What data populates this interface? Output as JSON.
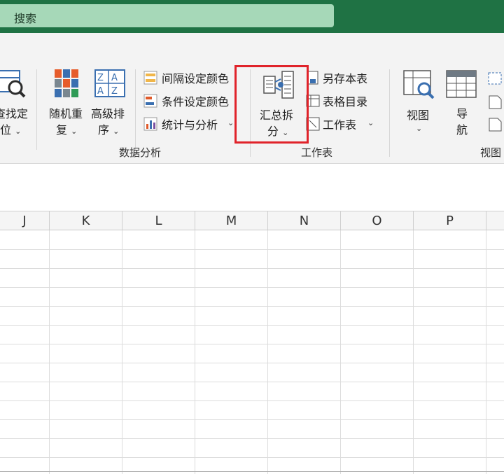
{
  "search": {
    "label": "搜索"
  },
  "ribbon": {
    "find_locate": {
      "line1": "查找定",
      "line2": "位"
    },
    "random_repeat": {
      "line1": "随机重",
      "line2": "复"
    },
    "advanced_sort": {
      "line1": "高级排",
      "line2": "序"
    },
    "interval_color": {
      "label": "间隔设定颜色"
    },
    "condition_color": {
      "label": "条件设定颜色"
    },
    "stats_analysis": {
      "label": "统计与分析"
    },
    "summary_split": {
      "line1": "汇总拆",
      "line2": "分"
    },
    "save_this_sheet": {
      "label": "另存本表"
    },
    "table_catalog": {
      "label": "表格目录"
    },
    "worksheet": {
      "label": "工作表"
    },
    "view": {
      "label": "视图"
    },
    "nav": {
      "line1": "导",
      "line2": "航"
    },
    "group_data_analysis": "数据分析",
    "group_worksheet": "工作表",
    "group_view": "视图"
  },
  "columns": [
    "J",
    "K",
    "L",
    "M",
    "N",
    "O",
    "P"
  ],
  "colors": {
    "titlebar": "#1f7244",
    "search_bg": "#a6d8b8",
    "highlight": "#e0232a"
  }
}
